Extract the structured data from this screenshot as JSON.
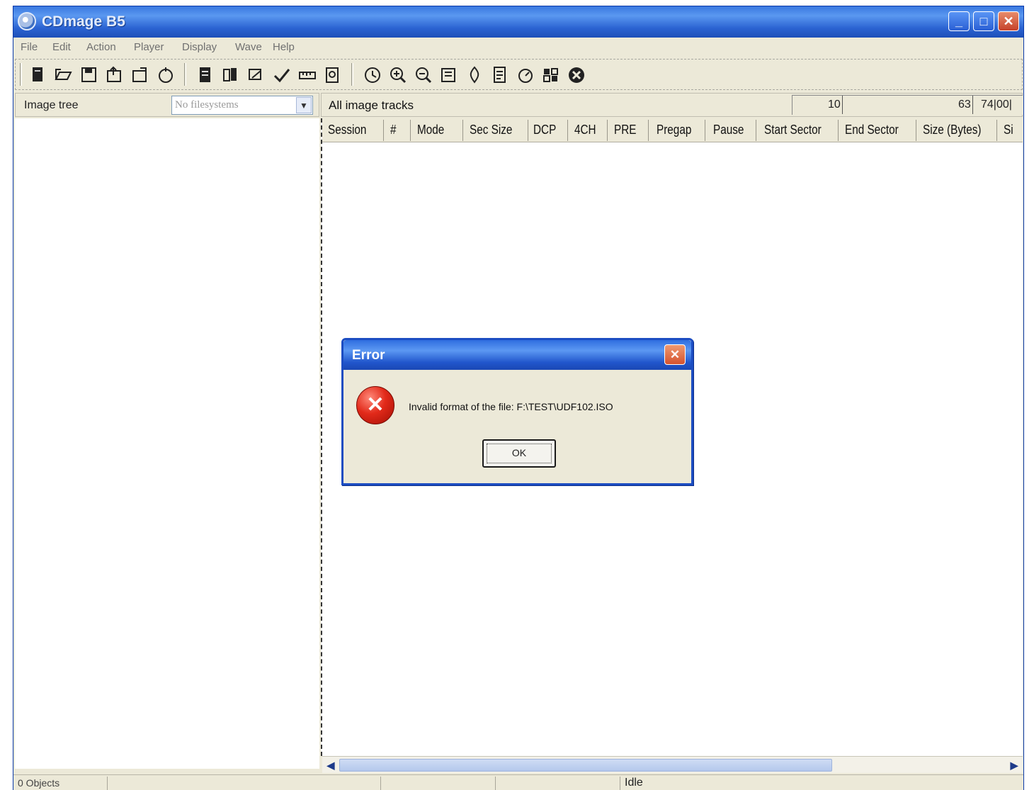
{
  "window": {
    "title": "CDmage B5"
  },
  "menu": {
    "items": [
      "File",
      "Edit",
      "Action",
      "Player",
      "Display",
      "Wave",
      "Help"
    ]
  },
  "toolbar": {
    "icons": [
      "new-icon",
      "open-icon",
      "save-icon",
      "export-icon",
      "import-icon",
      "refresh-icon",
      "doc-icon",
      "track-edit-icon",
      "scan-icon",
      "check-icon",
      "ruler-icon",
      "find-icon",
      "clock-icon",
      "zoom-in-icon",
      "zoom-out-icon",
      "map-icon",
      "fire-icon",
      "page-icon",
      "timer-icon",
      "grid-icon",
      "stop-icon"
    ]
  },
  "left_pane": {
    "title": "Image tree",
    "filesystem": "No filesystems"
  },
  "right_pane": {
    "title": "All image tracks",
    "ruler": {
      "mark1": "10",
      "mark2": "63",
      "mark3": "74|00|"
    },
    "columns": [
      "Session",
      "#",
      "Mode",
      "Sec Size",
      "DCP",
      "4CH",
      "PRE",
      "Pregap",
      "Pause",
      "Start Sector",
      "End Sector",
      "Size (Bytes)",
      "Si"
    ]
  },
  "status": {
    "objects": "0 Objects",
    "state": "Idle"
  },
  "dialog": {
    "title": "Error",
    "message": "Invalid format of the file: F:\\TEST\\UDF102.ISO",
    "ok_label": "OK"
  }
}
